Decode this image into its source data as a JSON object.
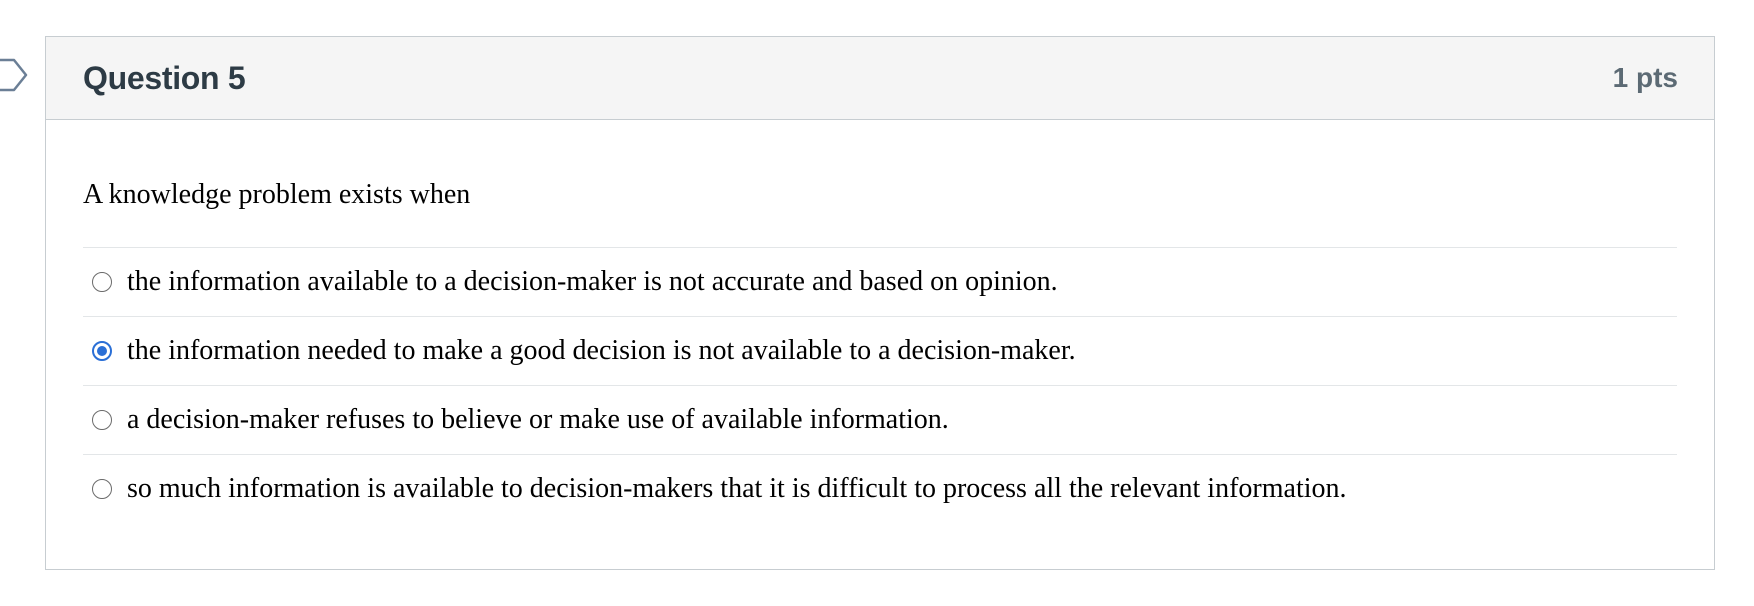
{
  "question": {
    "title": "Question 5",
    "points": "1 pts",
    "text": "A knowledge problem exists when",
    "answers": [
      {
        "label": "the information available to a decision-maker is not accurate and based on opinion.",
        "selected": false
      },
      {
        "label": "the information needed to make a good decision is not available to a decision-maker.",
        "selected": true
      },
      {
        "label": "a decision-maker refuses to believe or make use of available information.",
        "selected": false
      },
      {
        "label": "so much information is available to decision-makers that it is difficult to process all the relevant information.",
        "selected": false
      }
    ]
  },
  "colors": {
    "accent": "#2a6fd6",
    "header_bg": "#f5f5f5",
    "border": "#c7cdd1"
  },
  "icons": {
    "marker": "flag-marker-icon"
  }
}
